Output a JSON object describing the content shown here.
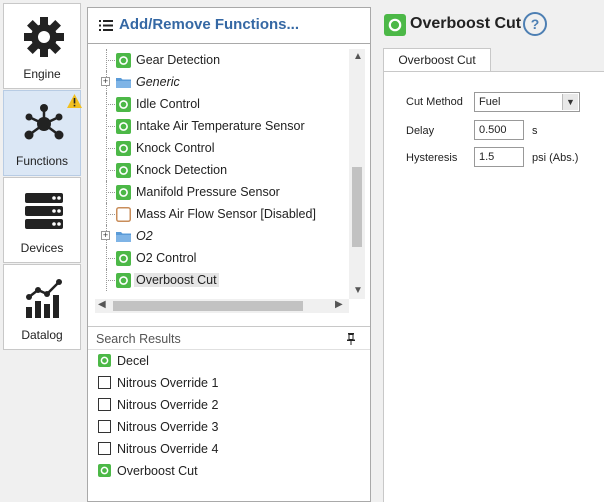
{
  "sidebar": {
    "items": [
      {
        "label": "Engine",
        "icon": "gear-icon"
      },
      {
        "label": "Functions",
        "icon": "network-icon",
        "active": true,
        "warning": true
      },
      {
        "label": "Devices",
        "icon": "server-icon"
      },
      {
        "label": "Datalog",
        "icon": "chart-icon"
      }
    ]
  },
  "panel": {
    "title": "Add/Remove Functions...",
    "tree": [
      {
        "label": "Gear Detection",
        "type": "function",
        "status": "enabled"
      },
      {
        "label": "Generic",
        "type": "folder"
      },
      {
        "label": "Idle Control",
        "type": "function",
        "status": "enabled"
      },
      {
        "label": "Intake Air Temperature Sensor",
        "type": "function",
        "status": "enabled"
      },
      {
        "label": "Knock Control",
        "type": "function",
        "status": "enabled"
      },
      {
        "label": "Knock Detection",
        "type": "function",
        "status": "enabled"
      },
      {
        "label": "Manifold Pressure Sensor",
        "type": "function",
        "status": "enabled"
      },
      {
        "label": "Mass Air Flow Sensor [Disabled]",
        "type": "function",
        "status": "disabled"
      },
      {
        "label": "O2",
        "type": "folder"
      },
      {
        "label": "O2 Control",
        "type": "function",
        "status": "enabled"
      },
      {
        "label": "Overboost Cut",
        "type": "function",
        "status": "enabled",
        "selected": true
      }
    ],
    "search_title": "Search Results",
    "results": [
      {
        "label": "Decel",
        "checked": true
      },
      {
        "label": "Nitrous Override 1",
        "checked": false
      },
      {
        "label": "Nitrous Override 2",
        "checked": false
      },
      {
        "label": "Nitrous Override 3",
        "checked": false
      },
      {
        "label": "Nitrous Override 4",
        "checked": false
      },
      {
        "label": "Overboost Cut",
        "checked": true
      }
    ]
  },
  "detail": {
    "title": "Overboost Cut",
    "help": "?",
    "tab": "Overboost Cut",
    "fields": {
      "cut_method": {
        "label": "Cut Method",
        "value": "Fuel"
      },
      "delay": {
        "label": "Delay",
        "value": "0.500",
        "unit": "s"
      },
      "hysteresis": {
        "label": "Hysteresis",
        "value": "1.5",
        "unit": "psi (Abs.)"
      }
    }
  },
  "colors": {
    "accent": "#3568a4",
    "enabled": "#4cb847",
    "disabled": "#c98d5a",
    "folder": "#5a9bd8"
  }
}
